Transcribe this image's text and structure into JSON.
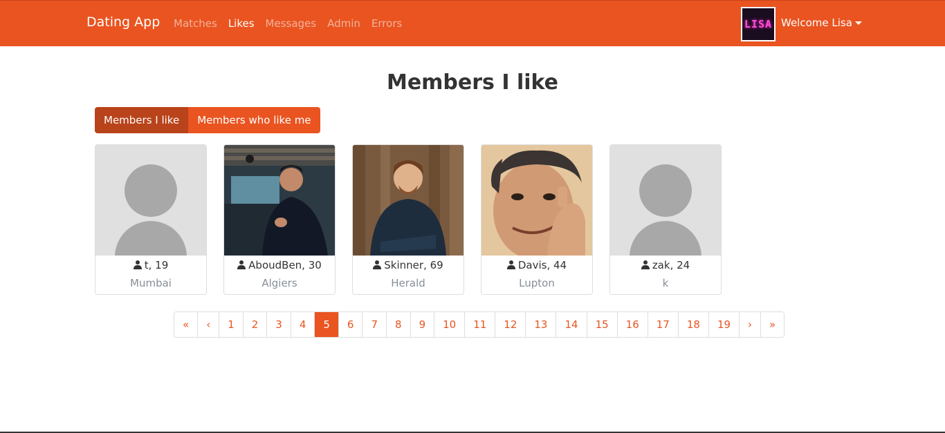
{
  "navbar": {
    "brand": "Dating App",
    "links": [
      "Matches",
      "Likes",
      "Messages",
      "Admin",
      "Errors"
    ],
    "active_link": "Likes",
    "avatar_text": "LISA",
    "welcome": "Welcome Lisa"
  },
  "page": {
    "title": "Members I like",
    "tabs": [
      "Members I like",
      "Members who like me"
    ]
  },
  "members": [
    {
      "name": "t, 19",
      "city": "Mumbai",
      "photo": "placeholder"
    },
    {
      "name": "AboudBen, 30",
      "city": "Algiers",
      "photo": "man-in-cafe"
    },
    {
      "name": "Skinner, 69",
      "city": "Herald",
      "photo": "man-in-shirt"
    },
    {
      "name": "Davis, 44",
      "city": "Lupton",
      "photo": "man-smiling"
    },
    {
      "name": "zak, 24",
      "city": "k",
      "photo": "placeholder"
    }
  ],
  "pagination": {
    "first": "«",
    "prev": "‹",
    "pages": [
      "1",
      "2",
      "3",
      "4",
      "5",
      "6",
      "7",
      "8",
      "9",
      "10",
      "11",
      "12",
      "13",
      "14",
      "15",
      "16",
      "17",
      "18",
      "19"
    ],
    "current": "5",
    "next": "›",
    "last": "»"
  },
  "colors": {
    "primary": "#E95420",
    "active_tab": "#b9431a"
  }
}
